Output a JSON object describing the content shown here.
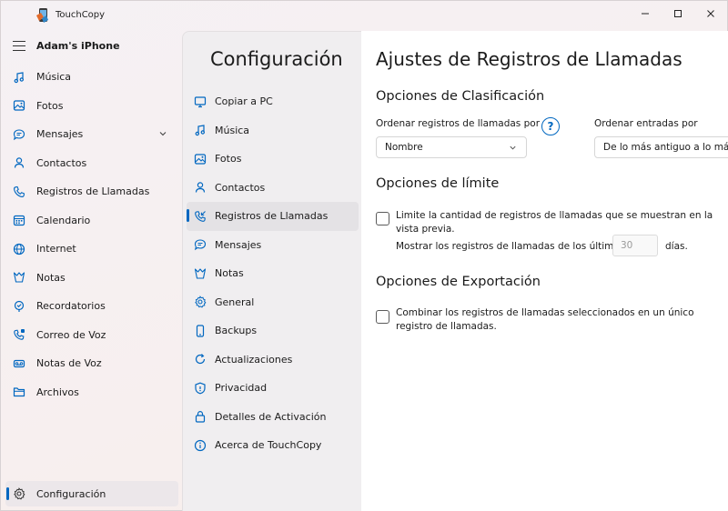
{
  "app": {
    "title": "TouchCopy",
    "device_name": "Adam's iPhone"
  },
  "nav": {
    "items": [
      {
        "label": "Música",
        "icon": "music-note-icon"
      },
      {
        "label": "Fotos",
        "icon": "photo-icon"
      },
      {
        "label": "Mensajes",
        "icon": "message-icon",
        "expandable": true
      },
      {
        "label": "Contactos",
        "icon": "person-icon"
      },
      {
        "label": "Registros de Llamadas",
        "icon": "phone-icon"
      },
      {
        "label": "Calendario",
        "icon": "calendar-icon"
      },
      {
        "label": "Internet",
        "icon": "globe-icon"
      },
      {
        "label": "Notas",
        "icon": "notes-icon"
      },
      {
        "label": "Recordatorios",
        "icon": "reminder-icon"
      },
      {
        "label": "Correo de Voz",
        "icon": "voicemail-icon"
      },
      {
        "label": "Notas de Voz",
        "icon": "voice-memo-icon"
      },
      {
        "label": "Archivos",
        "icon": "folder-icon"
      }
    ],
    "bottom_label": "Configuración"
  },
  "settings": {
    "title": "Configuración",
    "items": [
      {
        "label": "Copiar a PC"
      },
      {
        "label": "Música"
      },
      {
        "label": "Fotos"
      },
      {
        "label": "Contactos"
      },
      {
        "label": "Registros de Llamadas",
        "active": true
      },
      {
        "label": "Mensajes"
      },
      {
        "label": "Notas"
      },
      {
        "label": "General"
      },
      {
        "label": "Backups"
      },
      {
        "label": "Actualizaciones"
      },
      {
        "label": "Privacidad"
      },
      {
        "label": "Detalles de Activación"
      },
      {
        "label": "Acerca de TouchCopy"
      }
    ]
  },
  "content": {
    "title": "Ajustes de Registros de Llamadas",
    "sorting": {
      "title": "Opciones de Clasificación",
      "sort_label": "Ordenar registros de llamadas por",
      "sort_value": "Nombre",
      "help_glyph": "?",
      "order_label": "Ordenar entradas por",
      "order_value": "De lo más antiguo a lo más reciente"
    },
    "limit": {
      "title": "Opciones de límite",
      "checkbox_label": "Limite la cantidad de registros de llamadas que se muestran en la vista previa.",
      "checked": false,
      "show_label": "Mostrar los registros de llamadas de los últimos",
      "days_value": "30",
      "days_unit": "días."
    },
    "export": {
      "title": "Opciones de Exportación",
      "checkbox_label": "Combinar los registros de llamadas seleccionados en un único registro de llamadas.",
      "checked": false
    }
  },
  "colors": {
    "accent": "#0067c0"
  }
}
